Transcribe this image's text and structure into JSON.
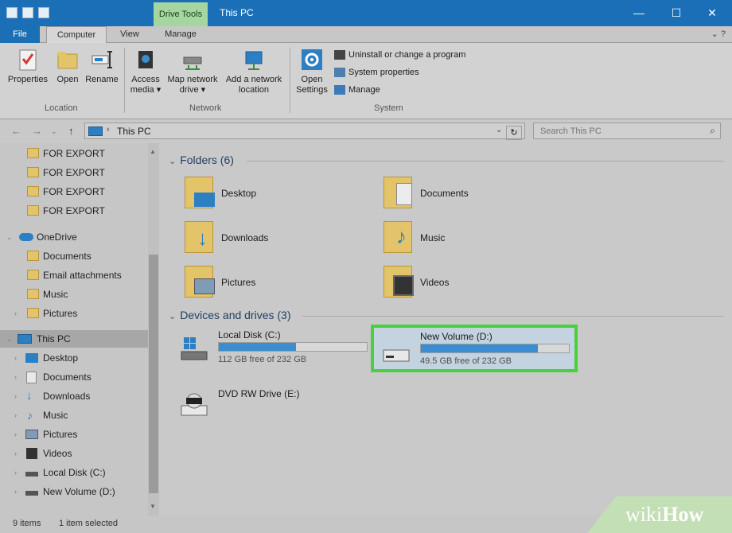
{
  "titlebar": {
    "drive_tools": "Drive Tools",
    "title": "This PC",
    "minimize": "—",
    "maximize": "☐",
    "close": "✕"
  },
  "tabs": {
    "file": "File",
    "computer": "Computer",
    "view": "View",
    "manage": "Manage",
    "help_glyph": "⌄  ?"
  },
  "ribbon": {
    "properties": "Properties",
    "open": "Open",
    "rename": "Rename",
    "access_media_1": "Access",
    "access_media_2": "media ▾",
    "map_drive_1": "Map network",
    "map_drive_2": "drive ▾",
    "add_location_1": "Add a network",
    "add_location_2": "location",
    "open_settings_1": "Open",
    "open_settings_2": "Settings",
    "uninstall": "Uninstall or change a program",
    "system_properties": "System properties",
    "manage": "Manage",
    "groups": {
      "location": "Location",
      "network": "Network",
      "system": "System"
    }
  },
  "address": {
    "path": "This PC",
    "search_placeholder": "Search This PC"
  },
  "nav": {
    "items": [
      {
        "label": "FOR EXPORT",
        "icon": "folder-icon"
      },
      {
        "label": "FOR EXPORT",
        "icon": "folder-icon"
      },
      {
        "label": "FOR EXPORT",
        "icon": "folder-icon"
      },
      {
        "label": "FOR EXPORT",
        "icon": "folder-icon"
      },
      {
        "label": "OneDrive",
        "icon": "onedrive-icon"
      },
      {
        "label": "Documents",
        "icon": "folder-icon"
      },
      {
        "label": "Email attachments",
        "icon": "folder-icon"
      },
      {
        "label": "Music",
        "icon": "folder-icon"
      },
      {
        "label": "Pictures",
        "icon": "folder-icon"
      },
      {
        "label": "This PC",
        "icon": "computer-icon"
      },
      {
        "label": "Desktop",
        "icon": "desktop-icon"
      },
      {
        "label": "Documents",
        "icon": "documents-icon"
      },
      {
        "label": "Downloads",
        "icon": "downloads-icon"
      },
      {
        "label": "Music",
        "icon": "music-icon"
      },
      {
        "label": "Pictures",
        "icon": "pictures-icon"
      },
      {
        "label": "Videos",
        "icon": "videos-icon"
      },
      {
        "label": "Local Disk (C:)",
        "icon": "drive-icon"
      },
      {
        "label": "New Volume (D:)",
        "icon": "drive-icon"
      }
    ]
  },
  "content": {
    "folders_header": "Folders (6)",
    "folders": [
      {
        "label": "Desktop"
      },
      {
        "label": "Documents"
      },
      {
        "label": "Downloads"
      },
      {
        "label": "Music"
      },
      {
        "label": "Pictures"
      },
      {
        "label": "Videos"
      }
    ],
    "devices_header": "Devices and drives (3)",
    "drives": [
      {
        "name": "Local Disk (C:)",
        "free": "112 GB free of 232 GB",
        "used_fraction": 0.52
      },
      {
        "name": "New Volume (D:)",
        "free": "49.5 GB free of 232 GB",
        "used_fraction": 0.79
      },
      {
        "name": "DVD RW Drive (E:)",
        "free": "",
        "used_fraction": null
      }
    ]
  },
  "status": {
    "count": "9 items",
    "selected": "1 item selected"
  },
  "watermark": {
    "wiki": "wiki",
    "how": "How"
  },
  "colors": {
    "titlebar": "#1a6fb7",
    "drive_tools": "#a6d6a0",
    "highlight": "#47d13b",
    "bar_fill": "#3a8dd1"
  }
}
